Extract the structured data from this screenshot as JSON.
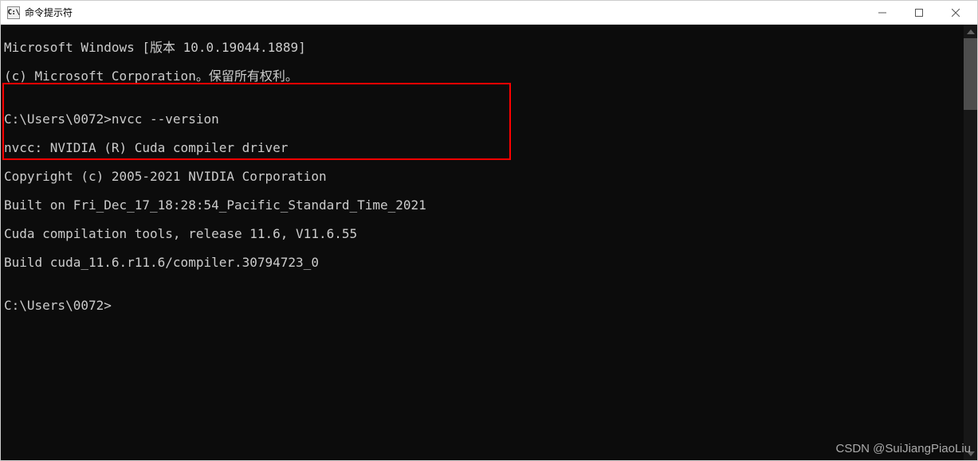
{
  "window": {
    "icon_text": "C:\\",
    "title": "命令提示符"
  },
  "terminal": {
    "line0": "Microsoft Windows [版本 10.0.19044.1889]",
    "line1": "(c) Microsoft Corporation。保留所有权利。",
    "line2": "",
    "line3": "C:\\Users\\0072>nvcc --version",
    "line4": "nvcc: NVIDIA (R) Cuda compiler driver",
    "line5": "Copyright (c) 2005-2021 NVIDIA Corporation",
    "line6": "Built on Fri_Dec_17_18:28:54_Pacific_Standard_Time_2021",
    "line7": "Cuda compilation tools, release 11.6, V11.6.55",
    "line8": "Build cuda_11.6.r11.6/compiler.30794723_0",
    "line9": "",
    "line10": "C:\\Users\\0072>"
  },
  "watermark": "CSDN @SuiJiangPiaoLiu"
}
